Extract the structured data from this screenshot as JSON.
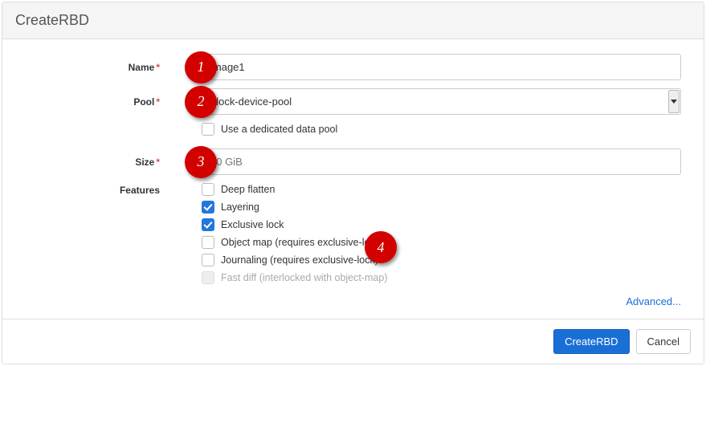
{
  "header": {
    "title": "CreateRBD"
  },
  "form": {
    "name": {
      "label": "Name",
      "value": "image1"
    },
    "pool": {
      "label": "Pool",
      "value": "block-device-pool"
    },
    "dedicated_pool": {
      "label": "Use a dedicated data pool",
      "checked": false
    },
    "size": {
      "label": "Size",
      "placeholder": "10 GiB"
    },
    "features": {
      "label": "Features",
      "items": [
        {
          "label": "Deep flatten",
          "checked": false,
          "disabled": false
        },
        {
          "label": "Layering",
          "checked": true,
          "disabled": false
        },
        {
          "label": "Exclusive lock",
          "checked": true,
          "disabled": false
        },
        {
          "label": "Object map (requires exclusive-lock)",
          "checked": false,
          "disabled": false
        },
        {
          "label": "Journaling (requires exclusive-lock)",
          "checked": false,
          "disabled": false
        },
        {
          "label": "Fast diff (interlocked with object-map)",
          "checked": false,
          "disabled": true
        }
      ]
    },
    "advanced_label": "Advanced..."
  },
  "footer": {
    "primary": "CreateRBD",
    "secondary": "Cancel"
  },
  "annotations": {
    "1": "1",
    "2": "2",
    "3": "3",
    "4": "4"
  }
}
